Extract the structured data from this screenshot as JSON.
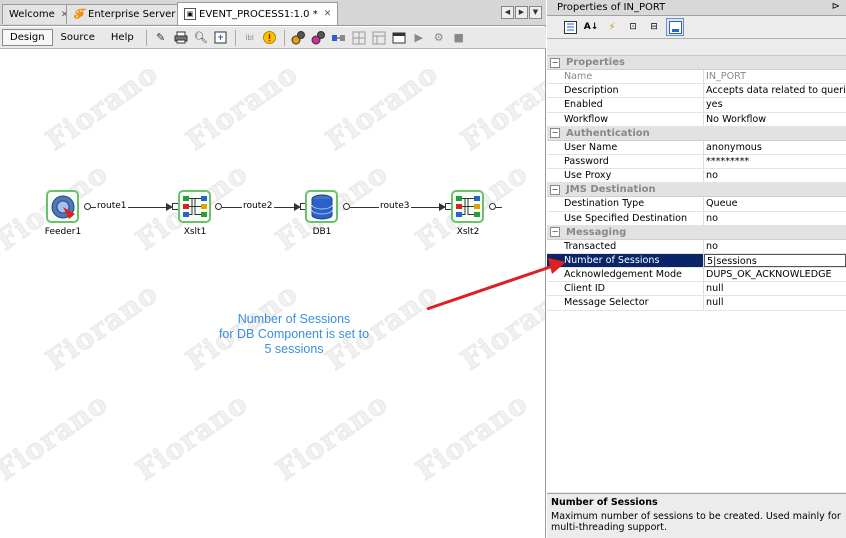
{
  "tabs": [
    {
      "label": "Welcome",
      "icon": "none",
      "active": false
    },
    {
      "label": "Enterprise Server",
      "icon": "fiorano-icon",
      "active": false
    },
    {
      "label": "EVENT_PROCESS1:1.0 *",
      "icon": "event-process-icon",
      "active": true
    }
  ],
  "toolbar": {
    "design_label": "Design",
    "source_label": "Source",
    "help_label": "Help"
  },
  "watermark_text": "Fiorano",
  "flow": {
    "nodes": [
      {
        "id": "feeder1",
        "label": "Feeder1"
      },
      {
        "id": "xslt1",
        "label": "Xslt1"
      },
      {
        "id": "db1",
        "label": "DB1"
      },
      {
        "id": "xslt2",
        "label": "Xslt2"
      }
    ],
    "routes": [
      {
        "label": "route1"
      },
      {
        "label": "route2"
      },
      {
        "label": "route3"
      }
    ]
  },
  "annotation": {
    "line1": "Number of Sessions",
    "line2": "for DB Component is set to",
    "line3": "5 sessions"
  },
  "properties": {
    "title": "Properties of IN_PORT",
    "categories": [
      {
        "name": "Properties",
        "rows": [
          {
            "name": "Name",
            "value": "IN_PORT",
            "readonly": true
          },
          {
            "name": "Description",
            "value": "Accepts data related to queries i..."
          },
          {
            "name": "Enabled",
            "value": "yes"
          },
          {
            "name": "Workflow",
            "value": "No Workflow"
          }
        ]
      },
      {
        "name": "Authentication",
        "rows": [
          {
            "name": "User Name",
            "value": "anonymous"
          },
          {
            "name": "Password",
            "value": "*********"
          },
          {
            "name": "Use Proxy",
            "value": "no"
          }
        ]
      },
      {
        "name": "JMS Destination",
        "rows": [
          {
            "name": "Destination Type",
            "value": "Queue"
          },
          {
            "name": "Use Specified Destination",
            "value": "no"
          }
        ]
      },
      {
        "name": "Messaging",
        "rows": [
          {
            "name": "Transacted",
            "value": "no"
          },
          {
            "name": "Number of Sessions",
            "value": "5|sessions",
            "selected": true
          },
          {
            "name": "Acknowledgement Mode",
            "value": "DUPS_OK_ACKNOWLEDGE"
          },
          {
            "name": "Client ID",
            "value": "null"
          },
          {
            "name": "Message Selector",
            "value": "null"
          }
        ]
      }
    ],
    "description": {
      "title": "Number of Sessions",
      "text": "Maximum number of sessions to be created. Used mainly for multi-threading support."
    }
  },
  "colors": {
    "node_border": "#6dc06d",
    "annotation": "#3a8fe0",
    "selection": "#0a246a",
    "arrow": "#e02020"
  }
}
